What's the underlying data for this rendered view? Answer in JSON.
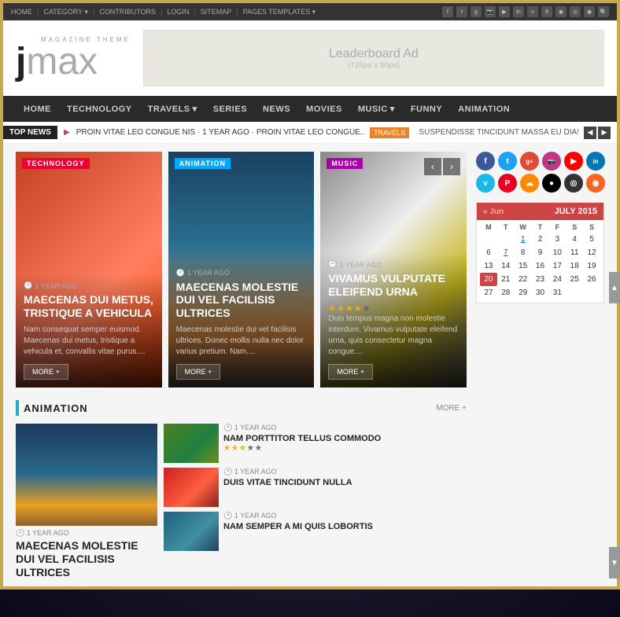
{
  "topbar": {
    "nav_items": [
      "HOME",
      "CATEGORY",
      "CONTRIBUTORS",
      "LOGIN",
      "SITEMAP",
      "PAGES TEMPLATES"
    ],
    "social_icons": [
      "f",
      "t",
      "g",
      "ig",
      "sc",
      "in",
      "v",
      "8",
      "sp",
      "gh",
      "rss",
      "🔍"
    ]
  },
  "header": {
    "logo_magazine": "MAGAZINE THEME",
    "logo_j": "j",
    "logo_max": "max",
    "ad_title": "Leaderboard Ad",
    "ad_size": "(728px x 90px)"
  },
  "main_nav": {
    "items": [
      {
        "label": "HOME",
        "has_dropdown": false
      },
      {
        "label": "TECHNOLOGY",
        "has_dropdown": false
      },
      {
        "label": "TRAVELS",
        "has_dropdown": true
      },
      {
        "label": "SERIES",
        "has_dropdown": false
      },
      {
        "label": "NEWS",
        "has_dropdown": false
      },
      {
        "label": "MOVIES",
        "has_dropdown": false
      },
      {
        "label": "MUSIC",
        "has_dropdown": true
      },
      {
        "label": "FUNNY",
        "has_dropdown": false
      },
      {
        "label": "ANIMATION",
        "has_dropdown": false
      }
    ]
  },
  "ticker": {
    "label": "TOP NEWS",
    "arrow": "▶",
    "text": "PROIN VITAE LEO CONGUE NIS · 1 YEAR AGO · PROIN VITAE LEO CONGUE...",
    "tag": "TRAVELS",
    "more_text": "SUSPENDISSE TINCIDUNT MASSA EU DIA!"
  },
  "featured_cards": [
    {
      "category": "TECHNOLOGY",
      "time": "1 YEAR AGO",
      "title": "MAECENAS DUI METUS, TRISTIQUE A VEHICULA",
      "description": "Nam consequat semper euismod. Maecenas dui metus, tristique a vehicula et, convallis vitae purus....",
      "btn": "MORE +"
    },
    {
      "category": "ANIMATION",
      "time": "1 YEAR AGO",
      "title": "MAECENAS MOLESTIE DUI VEL FACILISIS ULTRICES",
      "description": "Maecenas molestie dui vel facilisis ultrices. Donec mollis nulla nec dolor varius pretium. Nam....",
      "btn": "MORE +"
    },
    {
      "category": "MUSIC",
      "time": "1 YEAR AGO",
      "title": "VIVAMUS VULPUTATE ELEIFEND URNA",
      "description": "Duis tempus magna non molestie interdum. Vivamus vulputate eleifend urna, quis consectetur magna congue....",
      "btn": "MORE +",
      "rating": 4
    }
  ],
  "animation_section": {
    "title": "ANIMATION",
    "more": "MORE +",
    "main_item": {
      "time": "1 YEAR AGO",
      "title": "MAECENAS MOLESTIE DUI VEL FACILISIS ULTRICES"
    },
    "list_items": [
      {
        "time": "1 YEAR AGO",
        "title": "NAM PORTTITOR TELLUS COMMODO",
        "rating": 3
      },
      {
        "time": "1 YEAR AGO",
        "title": "DUIS VITAE TINCIDUNT NULLA"
      },
      {
        "time": "1 YEAR AGO",
        "title": "NAM SEMPER A MI QUIS LOBORTIS"
      }
    ]
  },
  "sidebar": {
    "social_icons": [
      {
        "icon": "f",
        "class": "soc-fb",
        "label": "facebook"
      },
      {
        "icon": "t",
        "class": "soc-tw",
        "label": "twitter"
      },
      {
        "icon": "g+",
        "class": "soc-gp",
        "label": "google-plus"
      },
      {
        "icon": "📷",
        "class": "soc-ig",
        "label": "instagram"
      },
      {
        "icon": "▶",
        "class": "soc-yt",
        "label": "youtube"
      },
      {
        "icon": "in",
        "class": "soc-li",
        "label": "linkedin"
      },
      {
        "icon": "v",
        "class": "soc-vi",
        "label": "vimeo"
      },
      {
        "icon": "P",
        "class": "soc-pin",
        "label": "pinterest"
      },
      {
        "icon": "☁",
        "class": "soc-sc",
        "label": "soundcloud"
      },
      {
        "icon": "●",
        "class": "soc-sp",
        "label": "spotify"
      },
      {
        "icon": "◎",
        "class": "soc-gh",
        "label": "github"
      },
      {
        "icon": "◉",
        "class": "soc-rss",
        "label": "rss"
      }
    ],
    "calendar": {
      "prev_label": "« Jun",
      "month": "JULY 2015",
      "day_headers": [
        "M",
        "T",
        "W",
        "T",
        "F",
        "S",
        "S"
      ],
      "days": [
        "",
        "",
        "1",
        "2",
        "3",
        "4",
        "5",
        "6",
        "7",
        "8",
        "9",
        "10",
        "11",
        "12",
        "13",
        "14",
        "15",
        "16",
        "17",
        "18",
        "19",
        "20",
        "21",
        "22",
        "23",
        "24",
        "25",
        "26",
        "27",
        "28",
        "29",
        "30",
        "31",
        "",
        ""
      ],
      "today": "20"
    }
  }
}
